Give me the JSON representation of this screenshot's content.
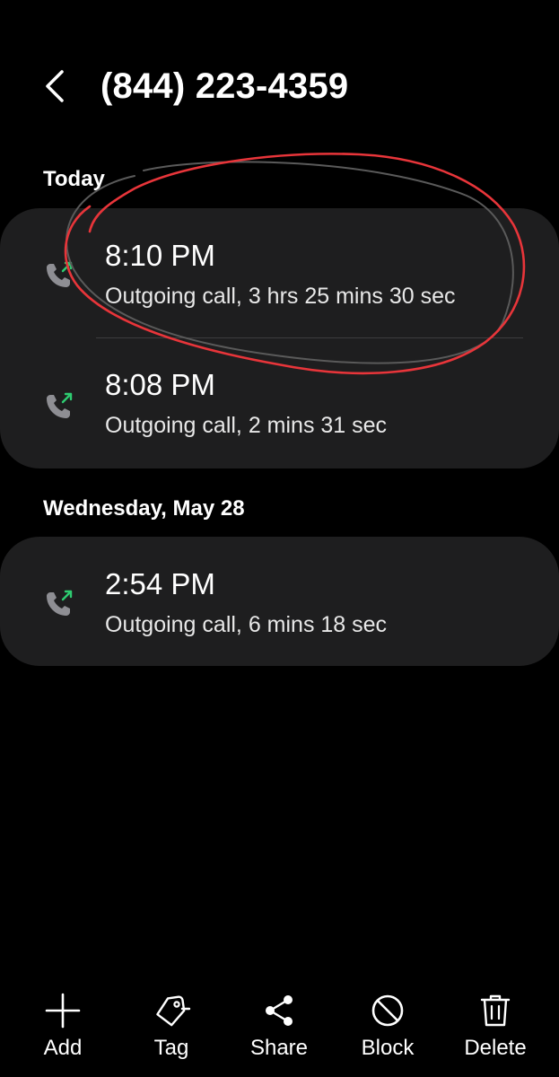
{
  "header": {
    "back_icon": "chevron-left-icon",
    "title": "(844) 223-4359"
  },
  "sections": [
    {
      "label": "Today",
      "calls": [
        {
          "time": "8:10 PM",
          "description": "Outgoing call, 3 hrs 25 mins 30 sec",
          "icon": "outgoing-call-icon"
        },
        {
          "time": "8:08 PM",
          "description": "Outgoing call, 2 mins 31 sec",
          "icon": "outgoing-call-icon"
        }
      ]
    },
    {
      "label": "Wednesday, May 28",
      "calls": [
        {
          "time": "2:54 PM",
          "description": "Outgoing call, 6 mins 18 sec",
          "icon": "outgoing-call-icon"
        }
      ]
    }
  ],
  "toolbar": {
    "add_label": "Add",
    "tag_label": "Tag",
    "share_label": "Share",
    "block_label": "Block",
    "delete_label": "Delete"
  },
  "colors": {
    "background": "#000000",
    "card": "#1e1e1f",
    "outgoing_arrow": "#2ecc71",
    "annotation_red": "#e8353a"
  }
}
